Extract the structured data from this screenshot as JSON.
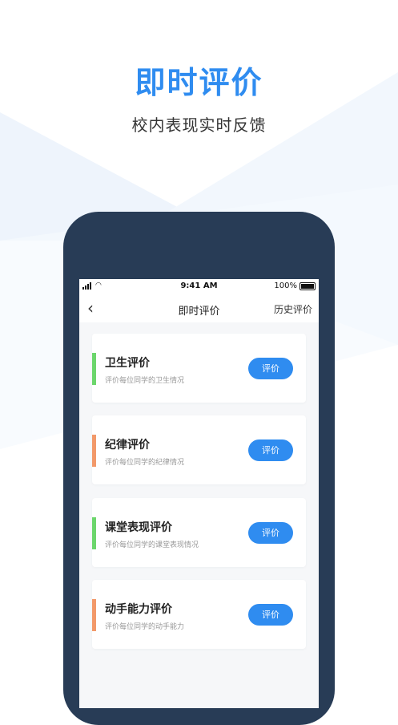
{
  "promo": {
    "title": "即时评价",
    "subtitle": "校内表现实时反馈"
  },
  "status": {
    "time": "9:41 AM",
    "battery": "100%"
  },
  "nav": {
    "back_icon": "chevron-left-icon",
    "title": "即时评价",
    "history": "历史评价"
  },
  "colors": {
    "primary": "#2f8cf0",
    "green": "#6cd66c",
    "orange": "#f2996a",
    "phone": "#283c56"
  },
  "cards": [
    {
      "title": "卫生评价",
      "desc": "评价每位同学的卫生情况",
      "button": "评价",
      "accent": "#6cd66c"
    },
    {
      "title": "纪律评价",
      "desc": "评价每位同学的纪律情况",
      "button": "评价",
      "accent": "#f2996a"
    },
    {
      "title": "课堂表现评价",
      "desc": "评价每位同学的课堂表现情况",
      "button": "评价",
      "accent": "#6cd66c"
    },
    {
      "title": "动手能力评价",
      "desc": "评价每位同学的动手能力",
      "button": "评价",
      "accent": "#f2996a"
    }
  ]
}
